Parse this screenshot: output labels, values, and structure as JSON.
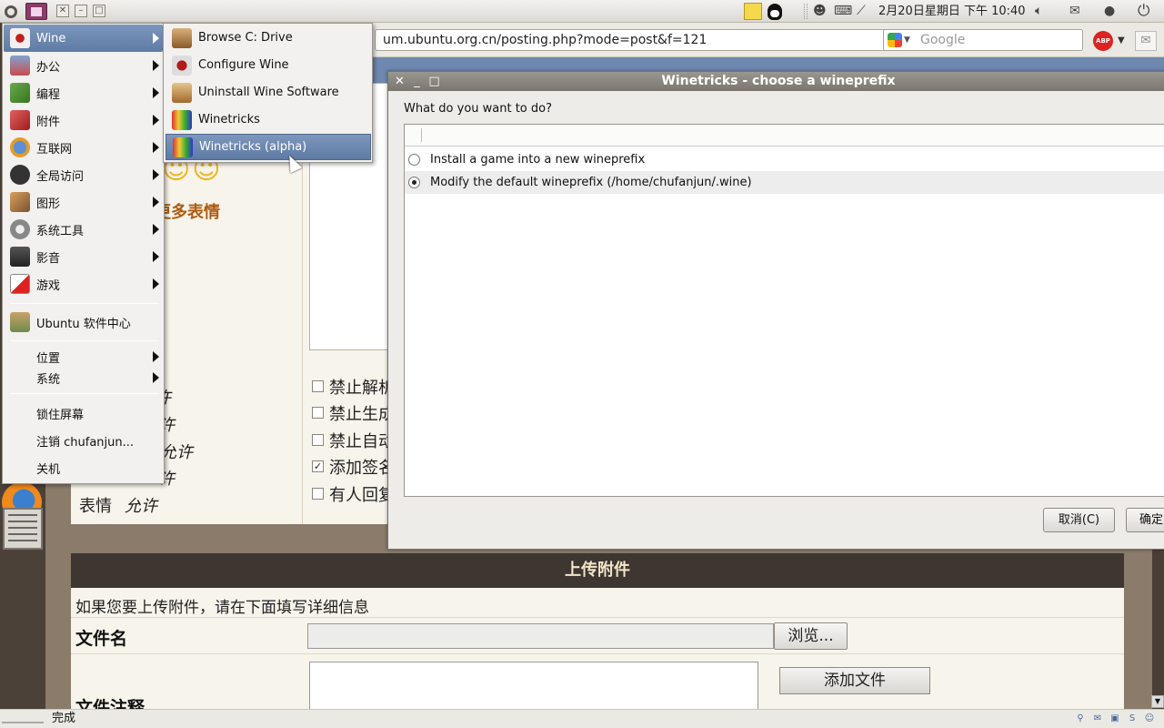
{
  "top_panel": {
    "clock": "2月20日星期日 下午 10:40",
    "icons": [
      "ubuntu-logo-icon",
      "app-switcher-icon",
      "close-icon",
      "minimize-icon",
      "maximize-icon",
      "sticky-notes-icon",
      "qq-icon",
      "qq-tray-icon",
      "keyboard-icon",
      "network-icon",
      "volume-icon",
      "mail-icon",
      "chat-icon",
      "power-icon"
    ]
  },
  "browser": {
    "url": "um.ubuntu.org.cn/posting.php?mode=post&f=121",
    "search_placeholder": "Google",
    "abp_label": "ABP",
    "status_text": "完成"
  },
  "page": {
    "more_emoticons": "更多表情",
    "options_left": [
      "许",
      "许",
      "允许",
      "许",
      "允许"
    ],
    "emoticons_label": "表情",
    "options_right": [
      "禁止解析",
      "禁止生成",
      "禁止自动",
      "添加签名",
      "有人回复"
    ],
    "upload_header": "上传附件",
    "upload_info": "如果您要上传附件，请在下面填写详细信息",
    "file_name_label": "文件名",
    "browse_button": "浏览...",
    "file_comment_label": "文件注释",
    "add_file_button": "添加文件"
  },
  "menu": {
    "items": [
      {
        "label": "Wine",
        "icon": "wine-icon",
        "arrow": true
      },
      {
        "label": "办公",
        "icon": "office-icon",
        "arrow": true
      },
      {
        "label": "编程",
        "icon": "programming-icon",
        "arrow": true
      },
      {
        "label": "附件",
        "icon": "accessories-icon",
        "arrow": true
      },
      {
        "label": "互联网",
        "icon": "internet-icon",
        "arrow": true
      },
      {
        "label": "全局访问",
        "icon": "accessibility-icon",
        "arrow": true
      },
      {
        "label": "图形",
        "icon": "graphics-icon",
        "arrow": true
      },
      {
        "label": "系统工具",
        "icon": "system-tools-icon",
        "arrow": true
      },
      {
        "label": "影音",
        "icon": "sound-video-icon",
        "arrow": true
      },
      {
        "label": "游戏",
        "icon": "games-icon",
        "arrow": true
      }
    ],
    "software_center": "Ubuntu 软件中心",
    "places": "位置",
    "system": "系统",
    "lock_screen": "锁住屏幕",
    "logout": "注销 chufanjun...",
    "shutdown": "关机"
  },
  "wine_submenu": [
    {
      "label": "Browse C: Drive",
      "icon": "browse-drive-icon"
    },
    {
      "label": "Configure Wine",
      "icon": "configure-wine-icon"
    },
    {
      "label": "Uninstall Wine Software",
      "icon": "uninstall-icon"
    },
    {
      "label": "Winetricks",
      "icon": "winetricks-icon"
    },
    {
      "label": "Winetricks (alpha)",
      "icon": "winetricks-alpha-icon"
    }
  ],
  "dialog": {
    "title": "Winetricks - choose a wineprefix",
    "prompt": "What do you want to do?",
    "options": [
      {
        "label": "Install a game into a new wineprefix",
        "selected": false
      },
      {
        "label": "Modify the default wineprefix (/home/chufanjun/.wine)",
        "selected": true
      }
    ],
    "cancel": "取消(C)",
    "ok": "确定"
  },
  "colors": {
    "menu_highlight": "#6b86ae",
    "dialog_title": "#8a867f",
    "page_header": "#3d3631"
  }
}
